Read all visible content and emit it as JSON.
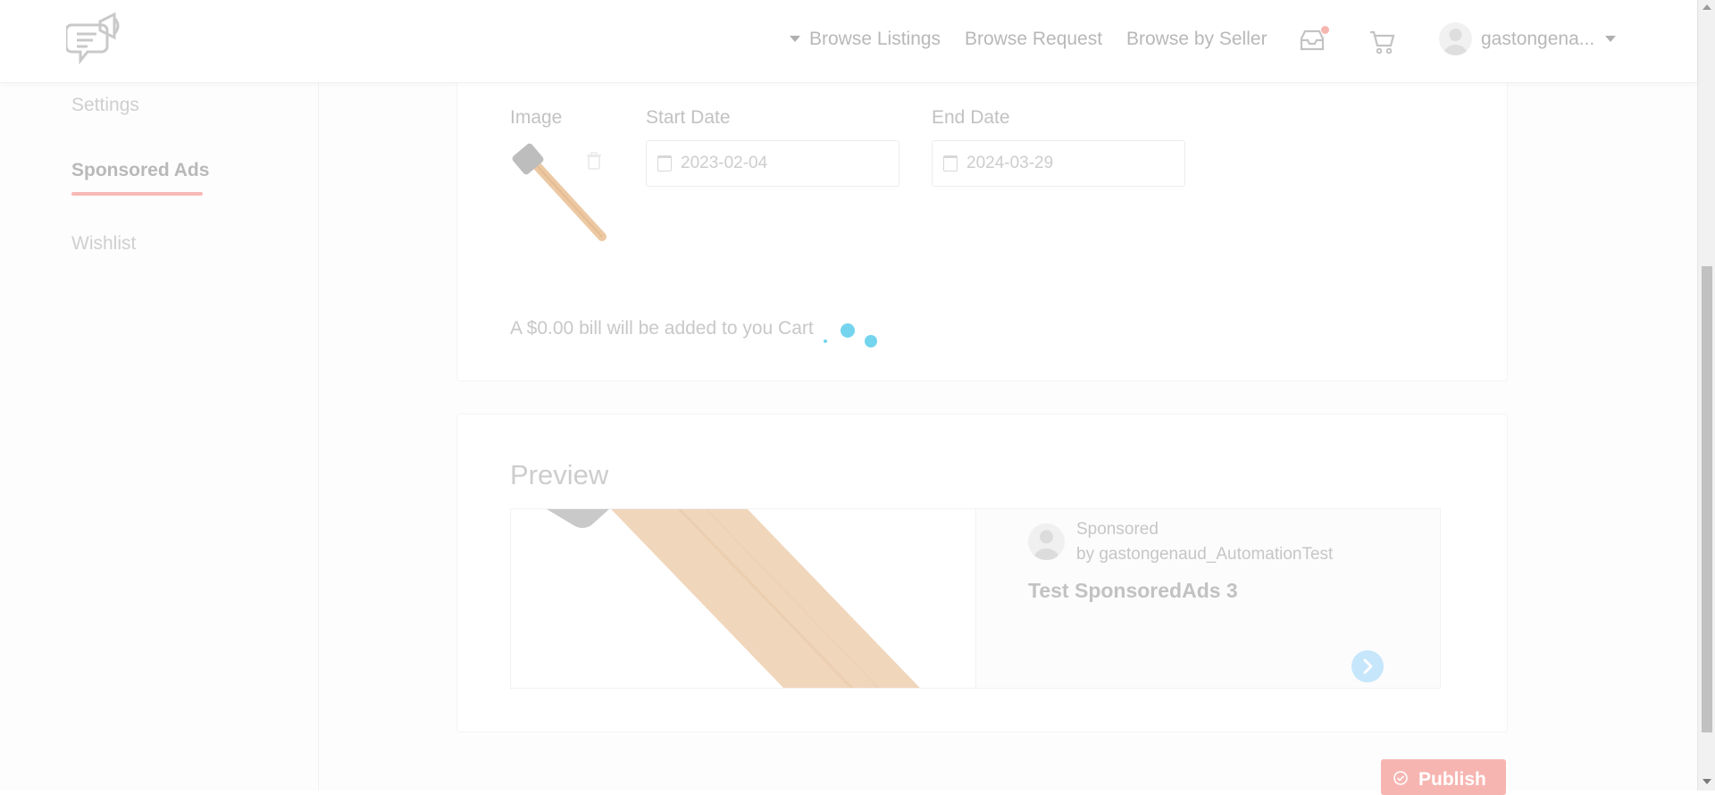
{
  "header": {
    "nav": {
      "browse_listings": "Browse Listings",
      "browse_request": "Browse Request",
      "browse_by_seller": "Browse by Seller"
    },
    "username": "gastongena...",
    "icons": [
      "logo-icon",
      "inbox-icon",
      "cart-icon",
      "avatar",
      "chevron-down-icon"
    ]
  },
  "sidebar": {
    "items": [
      {
        "label": "Settings"
      },
      {
        "label": "Sponsored Ads",
        "active": true
      },
      {
        "label": "Wishlist"
      }
    ]
  },
  "form": {
    "image_label": "Image",
    "start_date_label": "Start Date",
    "start_date_value": "2023-02-04",
    "end_date_label": "End Date",
    "end_date_value": "2024-03-29",
    "bill_text": "A $0.00 bill will be added to you Cart"
  },
  "preview": {
    "title": "Preview",
    "sponsored_label": "Sponsored",
    "by_text": "by gastongenaud_AutomationTest",
    "ad_title": "Test SponsoredAds 3"
  },
  "actions": {
    "publish_label": "Publish"
  },
  "colors": {
    "accent": "#f7b5b1",
    "spinner": "#74d4ee",
    "arrow_button": "#c6e6fb"
  }
}
